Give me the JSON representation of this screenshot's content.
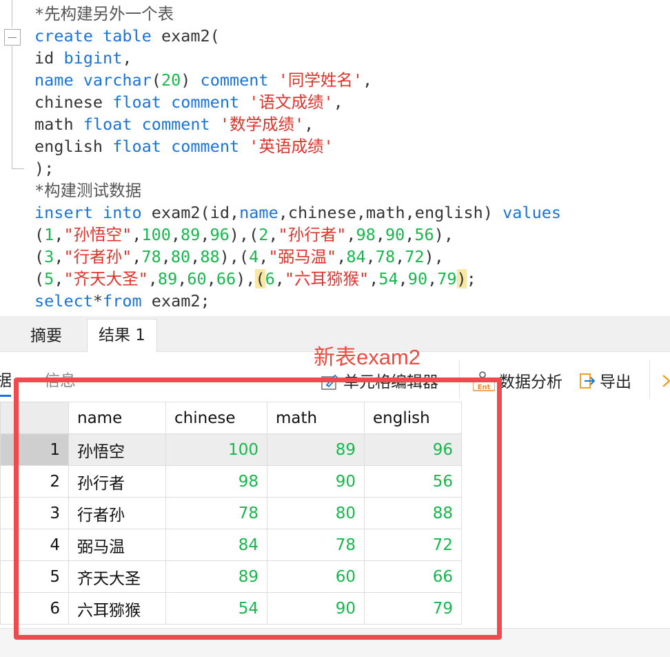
{
  "editor": {
    "lines": [
      [
        {
          "t": "*先构建另外一个表",
          "c": "cmt"
        }
      ],
      [
        {
          "t": "create",
          "c": "kw"
        },
        {
          "t": " "
        },
        {
          "t": "table",
          "c": "kw"
        },
        {
          "t": " exam2("
        }
      ],
      [
        {
          "t": "id "
        },
        {
          "t": "bigint",
          "c": "kw"
        },
        {
          "t": ","
        }
      ],
      [
        {
          "t": "name",
          "c": "kw"
        },
        {
          "t": " "
        },
        {
          "t": "varchar",
          "c": "kw"
        },
        {
          "t": "("
        },
        {
          "t": "20",
          "c": "num"
        },
        {
          "t": ") "
        },
        {
          "t": "comment",
          "c": "kw"
        },
        {
          "t": " "
        },
        {
          "t": "'同学姓名'",
          "c": "str"
        },
        {
          "t": ","
        }
      ],
      [
        {
          "t": "chinese "
        },
        {
          "t": "float",
          "c": "kw"
        },
        {
          "t": " "
        },
        {
          "t": "comment",
          "c": "kw"
        },
        {
          "t": " "
        },
        {
          "t": "'语文成绩'",
          "c": "str"
        },
        {
          "t": ","
        }
      ],
      [
        {
          "t": "math "
        },
        {
          "t": "float",
          "c": "kw"
        },
        {
          "t": " "
        },
        {
          "t": "comment",
          "c": "kw"
        },
        {
          "t": " "
        },
        {
          "t": "'数学成绩'",
          "c": "str"
        },
        {
          "t": ","
        }
      ],
      [
        {
          "t": "english "
        },
        {
          "t": "float",
          "c": "kw"
        },
        {
          "t": " "
        },
        {
          "t": "comment",
          "c": "kw"
        },
        {
          "t": " "
        },
        {
          "t": "'英语成绩'",
          "c": "str"
        }
      ],
      [
        {
          "t": ");"
        }
      ],
      [
        {
          "t": "*构建测试数据",
          "c": "cmt"
        }
      ],
      [
        {
          "t": "insert",
          "c": "kw"
        },
        {
          "t": " "
        },
        {
          "t": "into",
          "c": "kw"
        },
        {
          "t": " exam2(id,"
        },
        {
          "t": "name",
          "c": "kw"
        },
        {
          "t": ",chinese,math,english) "
        },
        {
          "t": "values",
          "c": "kw"
        }
      ],
      [
        {
          "t": "("
        },
        {
          "t": "1",
          "c": "num"
        },
        {
          "t": ","
        },
        {
          "t": "\"孙悟空\"",
          "c": "str"
        },
        {
          "t": ","
        },
        {
          "t": "100",
          "c": "num"
        },
        {
          "t": ","
        },
        {
          "t": "89",
          "c": "num"
        },
        {
          "t": ","
        },
        {
          "t": "96",
          "c": "num"
        },
        {
          "t": "),("
        },
        {
          "t": "2",
          "c": "num"
        },
        {
          "t": ","
        },
        {
          "t": "\"孙行者\"",
          "c": "str"
        },
        {
          "t": ","
        },
        {
          "t": "98",
          "c": "num"
        },
        {
          "t": ","
        },
        {
          "t": "90",
          "c": "num"
        },
        {
          "t": ","
        },
        {
          "t": "56",
          "c": "num"
        },
        {
          "t": "),"
        }
      ],
      [
        {
          "t": "("
        },
        {
          "t": "3",
          "c": "num"
        },
        {
          "t": ","
        },
        {
          "t": "\"行者孙\"",
          "c": "str"
        },
        {
          "t": ","
        },
        {
          "t": "78",
          "c": "num"
        },
        {
          "t": ","
        },
        {
          "t": "80",
          "c": "num"
        },
        {
          "t": ","
        },
        {
          "t": "88",
          "c": "num"
        },
        {
          "t": "),("
        },
        {
          "t": "4",
          "c": "num"
        },
        {
          "t": ","
        },
        {
          "t": "\"弼马温\"",
          "c": "str"
        },
        {
          "t": ","
        },
        {
          "t": "84",
          "c": "num"
        },
        {
          "t": ","
        },
        {
          "t": "78",
          "c": "num"
        },
        {
          "t": ","
        },
        {
          "t": "72",
          "c": "num"
        },
        {
          "t": "),"
        }
      ],
      [
        {
          "t": "("
        },
        {
          "t": "5",
          "c": "num"
        },
        {
          "t": ","
        },
        {
          "t": "\"齐天大圣\"",
          "c": "str"
        },
        {
          "t": ","
        },
        {
          "t": "89",
          "c": "num"
        },
        {
          "t": ","
        },
        {
          "t": "60",
          "c": "num"
        },
        {
          "t": ","
        },
        {
          "t": "66",
          "c": "num"
        },
        {
          "t": "),"
        },
        {
          "t": "(",
          "c": "hl"
        },
        {
          "t": "6",
          "c": "num"
        },
        {
          "t": ","
        },
        {
          "t": "\"六耳猕猴\"",
          "c": "str"
        },
        {
          "t": ","
        },
        {
          "t": "54",
          "c": "num"
        },
        {
          "t": ","
        },
        {
          "t": "90",
          "c": "num"
        },
        {
          "t": ","
        },
        {
          "t": "79",
          "c": "num"
        },
        {
          "t": ")",
          "c": "hl"
        },
        {
          "t": ";"
        }
      ],
      [
        {
          "t": "select",
          "c": "kw"
        },
        {
          "t": "*"
        },
        {
          "t": "from",
          "c": "kw"
        },
        {
          "t": " exam2;"
        }
      ]
    ]
  },
  "tabs": {
    "summary": "摘要",
    "result": "结果 1"
  },
  "toolbar": {
    "data_tab": "据",
    "info_tab": "信息",
    "cell_editor": "单元格编辑器",
    "data_analysis": "数据分析",
    "export": "导出",
    "analysis_icon_text": "Ent"
  },
  "annotation": "新表exam2",
  "grid": {
    "columns": [
      "name",
      "chinese",
      "math",
      "english"
    ],
    "rows": [
      {
        "n": "1",
        "name": "孙悟空",
        "chinese": "100",
        "math": "89",
        "english": "96"
      },
      {
        "n": "2",
        "name": "孙行者",
        "chinese": "98",
        "math": "90",
        "english": "56"
      },
      {
        "n": "3",
        "name": "行者孙",
        "chinese": "78",
        "math": "80",
        "english": "88"
      },
      {
        "n": "4",
        "name": "弼马温",
        "chinese": "84",
        "math": "78",
        "english": "72"
      },
      {
        "n": "5",
        "name": "齐天大圣",
        "chinese": "89",
        "math": "60",
        "english": "66"
      },
      {
        "n": "6",
        "name": "六耳猕猴",
        "chinese": "54",
        "math": "90",
        "english": "79"
      }
    ],
    "selected_row": 1
  },
  "colors": {
    "keyword": "#1a73d9",
    "number": "#16b84c",
    "string": "#e0322a",
    "annotation": "#ee4b40",
    "highlight_box": "#ee4b4f"
  }
}
